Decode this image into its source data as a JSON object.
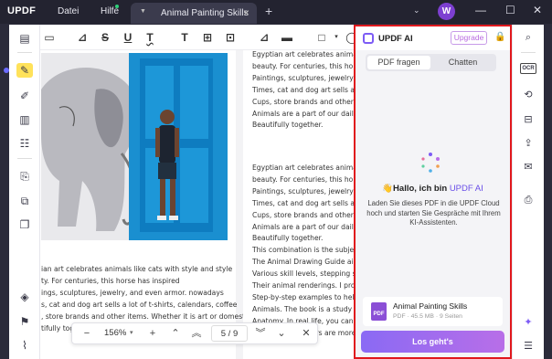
{
  "app": {
    "logo": "UPDF"
  },
  "menu": {
    "file": "Datei",
    "help": "Hilfe"
  },
  "tab": {
    "title": "Animal Painting Skills",
    "close": "×",
    "add": "+"
  },
  "avatar": {
    "initial": "W"
  },
  "window_controls": {
    "minimize": "—",
    "maximize": "☐",
    "close": "✕"
  },
  "toolbar": {
    "icons": [
      "comment-icon",
      "highlight-icon",
      "strikethrough-icon",
      "underline-icon",
      "squiggly-icon",
      "text-icon",
      "textbox-icon",
      "textcallout-icon",
      "pencil-icon",
      "eraser-icon",
      "shape-icon"
    ],
    "strike": "S",
    "underline": "U",
    "squiggly": "T",
    "text": "T"
  },
  "document": {
    "right_column_top": [
      "Egyptian art celebrates animal",
      "beauty. For centuries, this hors",
      "Paintings, sculptures, jewelry,",
      "Times, cat and dog art sells a l",
      "Cups, store brands and other it",
      "Animals are a part of our daily",
      "Beautifully together."
    ],
    "right_column_mid": [
      "Egyptian art celebrates animal",
      "beauty. For centuries, this hors",
      "Paintings, sculptures, jewelry,",
      "Times, cat and dog art sells a l",
      "Cups, store brands and other it",
      "Animals are a part of our daily",
      "Beautifully together.",
      "This combination is the subjec",
      "The Animal Drawing Guide aim",
      "Various skill levels, stepping st",
      "Their animal renderings. I prov",
      "Step-by-step examples to help",
      "Animals. The book is a study o",
      "Anatomy. In real life, you can",
      "Of simplicity. Others are more advance"
    ],
    "left_column": [
      "ian art celebrates animals like cats with style and style",
      "ty. For centuries, this horse has inspired",
      "ings, sculptures, jewelry, and even armor. nowadays",
      "s, cat and dog art sells a lot of t-shirts, calendars, coffee",
      ", store brands and other items. Whether it is art or domestic",
      "tifully together."
    ]
  },
  "zoombar": {
    "zoom": "156%",
    "current_page": "5",
    "total_pages": "9",
    "separator": "/",
    "minus": "−",
    "plus": "+",
    "close": "✕"
  },
  "ai": {
    "title": "UPDF AI",
    "upgrade": "Upgrade",
    "tabs": [
      "PDF fragen",
      "Chatten"
    ],
    "hello_prefix": "👋Hallo, ich bin ",
    "hello_accent": "UPDF AI",
    "description": "Laden Sie dieses PDF in die UPDF Cloud hoch und starten Sie Gespräche mit Ihrem KI-Assistenten.",
    "file_name": "Animal Painting Skills",
    "file_meta": "PDF · 45.5 MB · 9 Seiten",
    "file_type": "PDF",
    "go_button": "Los geht's",
    "brand_color": "#7d5cf5",
    "highlight_border": "#e0181d"
  },
  "leftbar": {
    "icons": [
      "reader-icon",
      "comment-tool-icon",
      "edit-icon",
      "organize-icon",
      "form-icon",
      "protect-icon",
      "crop-icon",
      "page-tools-icon",
      "layers-icon",
      "bookmark-icon",
      "attachment-icon"
    ]
  },
  "rightbar": {
    "icons": [
      "search-icon",
      "ocr-icon",
      "convert-icon",
      "compress-icon",
      "share-icon",
      "email-icon",
      "save-icon",
      "ai-assistant-icon",
      "chat-icon"
    ],
    "ocr_label": "OCR"
  }
}
